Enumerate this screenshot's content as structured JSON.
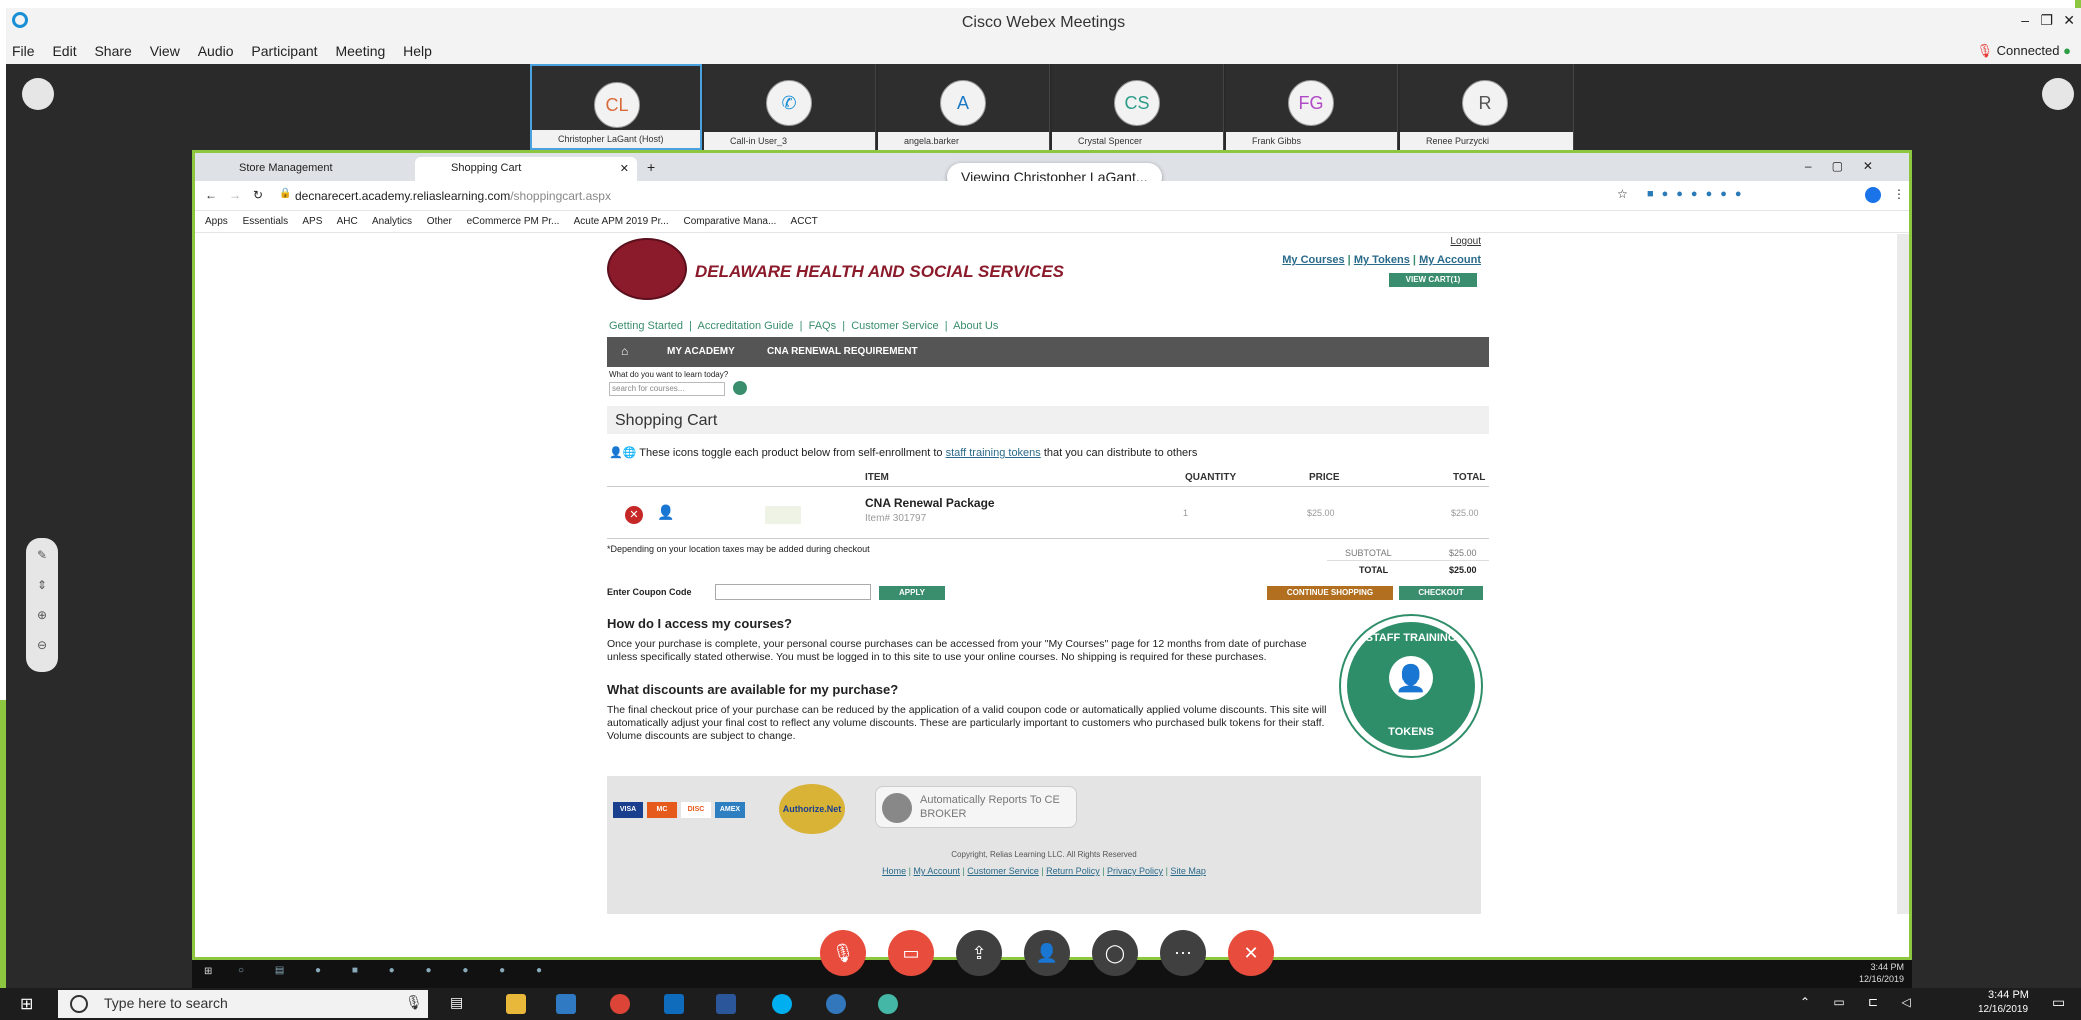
{
  "webex": {
    "title": "Cisco Webex Meetings",
    "menu": [
      "File",
      "Edit",
      "Share",
      "View",
      "Audio",
      "Participant",
      "Meeting",
      "Help"
    ],
    "status": "Connected",
    "participants": [
      {
        "initials": "CL",
        "name": "Christopher LaGant (Host)"
      },
      {
        "initials": "",
        "name": "Call-in User_3"
      },
      {
        "initials": "A",
        "name": "angela.barker"
      },
      {
        "initials": "CS",
        "name": "Crystal Spencer"
      },
      {
        "initials": "FG",
        "name": "Frank Gibbs"
      },
      {
        "initials": "R",
        "name": "Renee Purzycki"
      }
    ],
    "viewing_banner": "Viewing Christopher LaGant...",
    "controls": [
      "mute-icon",
      "video-icon",
      "share-icon",
      "participants-icon",
      "chat-icon",
      "more-icon",
      "leave-icon"
    ]
  },
  "browser": {
    "tabs": [
      {
        "label": "Store Management"
      },
      {
        "label": "Shopping Cart"
      }
    ],
    "url_host": "decnarecert.academy.reliaslearning.com",
    "url_path": "/shoppingcart.aspx",
    "bookmarks": [
      "Apps",
      "Essentials",
      "APS",
      "AHC",
      "Analytics",
      "Other",
      "eCommerce PM Pr...",
      "Acute APM 2019 Pr...",
      "Comparative Mana...",
      "ACCT"
    ]
  },
  "site": {
    "org": "DELAWARE HEALTH AND SOCIAL SERVICES",
    "logout": "Logout",
    "top_links": [
      "My Courses",
      "My Tokens",
      "My Account"
    ],
    "view_cart": "VIEW CART(1)",
    "sub_nav": [
      "Getting Started",
      "Accreditation Guide",
      "FAQs",
      "Customer Service",
      "About Us"
    ],
    "main_nav": [
      "MY ACADEMY",
      "CNA RENEWAL REQUIREMENT"
    ],
    "search_prompt": "What do you want to learn today?",
    "search_placeholder": "search for courses...",
    "cart_title": "Shopping Cart",
    "toggle_note_pre": "These icons toggle each product below from self-enrollment to",
    "toggle_note_link": "staff training tokens",
    "toggle_note_post": "that you can distribute to others",
    "cart_headers": [
      "ITEM",
      "QUANTITY",
      "PRICE",
      "TOTAL"
    ],
    "item": {
      "name": "CNA Renewal Package",
      "number": "Item# 301797",
      "quantity": "1",
      "price": "$25.00",
      "total": "$25.00"
    },
    "tax_note": "*Depending on your location taxes may be added during checkout",
    "subtotal_label": "SUBTOTAL",
    "subtotal": "$25.00",
    "total_label": "TOTAL",
    "total": "$25.00",
    "coupon_label": "Enter Coupon Code",
    "apply": "APPLY",
    "continue": "CONTINUE SHOPPING",
    "checkout": "CHECKOUT",
    "faq1_q": "How do I access my courses?",
    "faq1_a": "Once your purchase is complete, your personal course purchases can be accessed from your \"My Courses\" page for 12 months from date of purchase unless specifically stated otherwise. You must be logged in to this site to use your online courses. No shipping is required for these purchases.",
    "faq2_q": "What discounts are available for my purchase?",
    "faq2_a": "The final checkout price of your purchase can be reduced by the application of a valid coupon code or automatically applied volume discounts. This site will automatically adjust your final cost to reflect any volume discounts. These are particularly important to customers who purchased bulk tokens for their staff. Volume discounts are subject to change.",
    "badge_top": "STAFF TRAINING",
    "badge_bottom": "TOKENS",
    "cards": [
      "VISA",
      "MC",
      "DISC",
      "AMEX"
    ],
    "authorize": "Authorize.Net",
    "ce_broker": "Automatically Reports To CE BROKER",
    "copyright": "Copyright, Relias Learning LLC. All Rights Reserved",
    "footer_links": [
      "Home",
      "My Account",
      "Customer Service",
      "Return Policy",
      "Privacy Policy",
      "Site Map"
    ]
  },
  "inner_clock": {
    "time": "3:44 PM",
    "date": "12/16/2019"
  },
  "taskbar": {
    "search_placeholder": "Type here to search",
    "time": "3:44 PM",
    "date": "12/16/2019"
  },
  "colors": {
    "green_accent": "#8dc63f",
    "site_green": "#3a8e6e",
    "site_maroon": "#8b1a2b",
    "continue_btn": "#b16f1f",
    "leave_red": "#e74c3c"
  }
}
